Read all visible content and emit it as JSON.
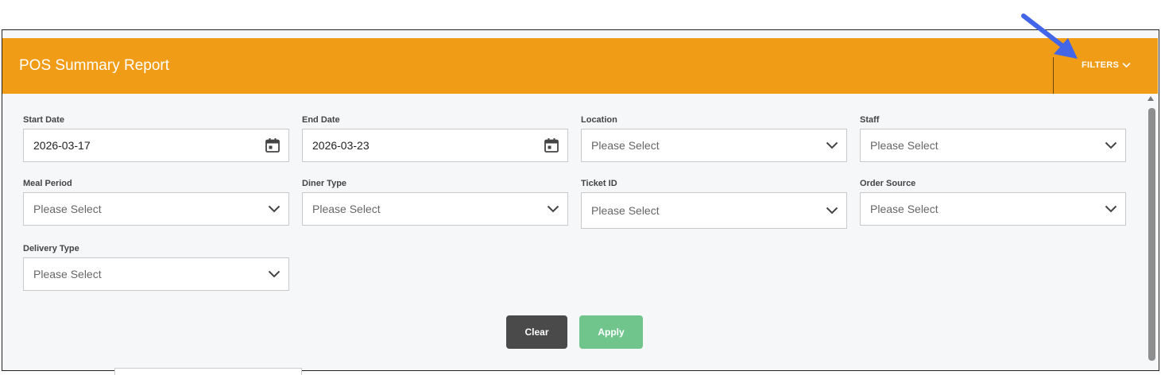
{
  "header": {
    "title": "POS Summary Report",
    "filters_label": "FILTERS"
  },
  "colors": {
    "header": "#f19c16",
    "clear": "#4a4a4a",
    "apply": "#6fc58c",
    "annotation_arrow": "#4366e8"
  },
  "fields": {
    "start_date": {
      "label": "Start Date",
      "value": "2026-03-17",
      "icon": "calendar-icon"
    },
    "end_date": {
      "label": "End Date",
      "value": "2026-03-23",
      "icon": "calendar-icon"
    },
    "location": {
      "label": "Location",
      "placeholder": "Please Select"
    },
    "staff": {
      "label": "Staff",
      "placeholder": "Please Select"
    },
    "meal_period": {
      "label": "Meal Period",
      "placeholder": "Please Select"
    },
    "diner_type": {
      "label": "Diner Type",
      "placeholder": "Please Select"
    },
    "ticket_id": {
      "label": "Ticket ID",
      "placeholder": "Please Select"
    },
    "order_source": {
      "label": "Order Source",
      "placeholder": "Please Select"
    },
    "delivery_type": {
      "label": "Delivery Type",
      "placeholder": "Please Select"
    }
  },
  "buttons": {
    "clear": "Clear",
    "apply": "Apply"
  }
}
